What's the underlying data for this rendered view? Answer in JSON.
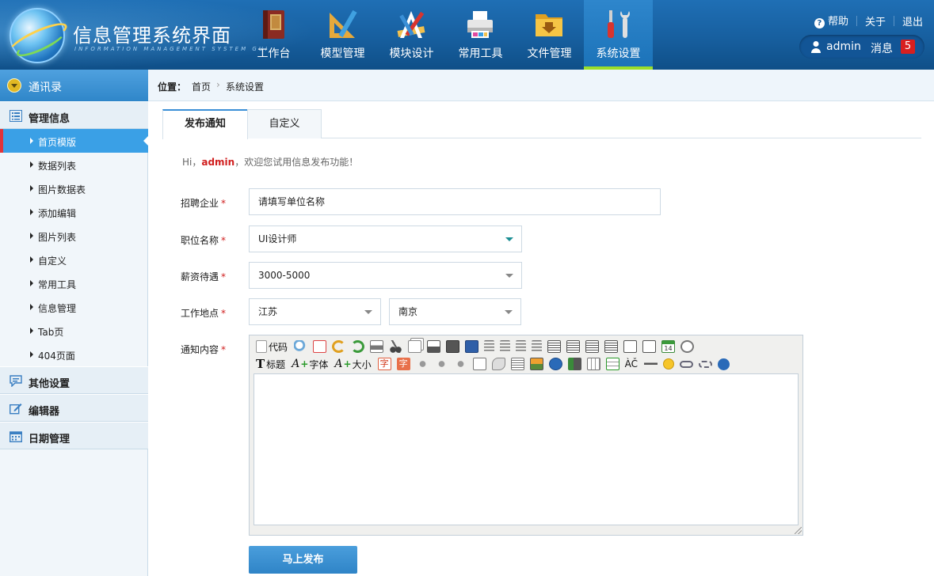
{
  "app": {
    "title": "信息管理系统界面",
    "subtitle": "INFORMATION MANAGEMENT SYSTEM GUI"
  },
  "nav": [
    {
      "label": "工作台",
      "icon": "book-icon"
    },
    {
      "label": "模型管理",
      "icon": "ruler-triangle-icon"
    },
    {
      "label": "模块设计",
      "icon": "design-tools-icon"
    },
    {
      "label": "常用工具",
      "icon": "printer-icon"
    },
    {
      "label": "文件管理",
      "icon": "folder-download-icon"
    },
    {
      "label": "系统设置",
      "icon": "wrench-screwdriver-icon",
      "active": true
    }
  ],
  "top_links": {
    "help": "帮助",
    "about": "关于",
    "logout": "退出"
  },
  "user": {
    "name": "admin",
    "messages_label": "消息",
    "message_count": "5"
  },
  "sidebar": {
    "main": "通讯录",
    "groups": [
      {
        "label": "管理信息",
        "icon": "list-icon"
      },
      {
        "label": "其他设置",
        "icon": "chat-icon"
      },
      {
        "label": "编辑器",
        "icon": "edit-icon"
      },
      {
        "label": "日期管理",
        "icon": "calendar-icon"
      }
    ],
    "items": [
      "首页模版",
      "数据列表",
      "图片数据表",
      "添加编辑",
      "图片列表",
      "自定义",
      "常用工具",
      "信息管理",
      "Tab页",
      "404页面"
    ]
  },
  "breadcrumb": {
    "label": "位置：",
    "home": "首页",
    "separator": "›",
    "current": "系统设置"
  },
  "tabs": [
    {
      "label": "发布通知",
      "active": true
    },
    {
      "label": "自定义",
      "active": false
    }
  ],
  "greeting": {
    "prefix": "Hi，",
    "user": "admin",
    "suffix": "，欢迎您试用信息发布功能！"
  },
  "form": {
    "company_label": "招聘企业",
    "company_value": "请填写单位名称",
    "position_label": "职位名称",
    "position_value": "UI设计师",
    "salary_label": "薪资待遇",
    "salary_value": "3000-5000",
    "location_label": "工作地点",
    "province_value": "江苏",
    "city_value": "南京",
    "content_label": "通知内容",
    "required_mark": "*"
  },
  "editor": {
    "code_label": "代码",
    "title_label": "标题",
    "font_label": "字体",
    "size_label": "大小",
    "char_a": "字",
    "char_b": "字",
    "letters_ac": "ÀČ",
    "cal_day": "14"
  },
  "submit_label": "马上发布",
  "colors": {
    "header": "#1a64a8",
    "accent": "#3aa0e6",
    "active_tab_underline": "#9adf2b",
    "required": "#d01e1e",
    "badge": "#d81f1f"
  }
}
